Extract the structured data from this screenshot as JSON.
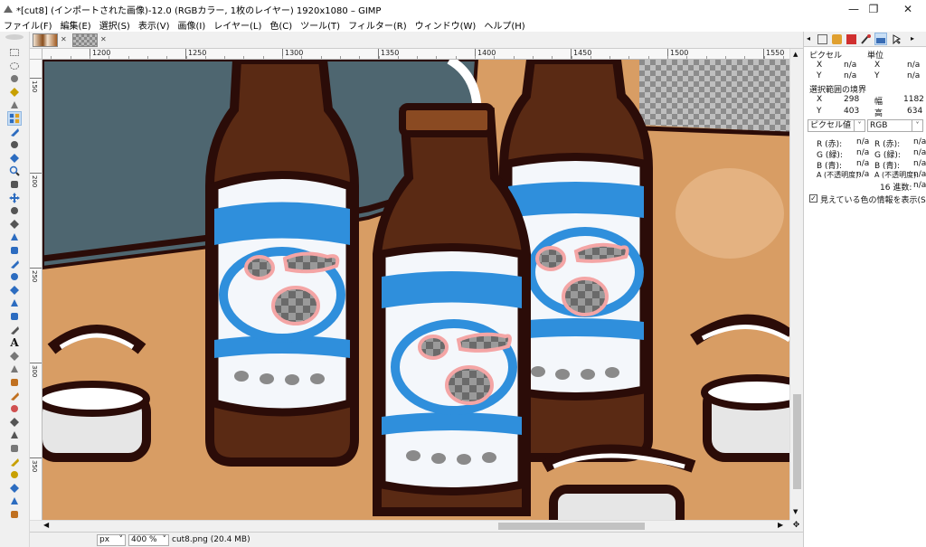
{
  "window": {
    "title": "*[cut8] (インポートされた画像)-12.0 (RGBカラー, 1枚のレイヤー) 1920x1080 – GIMP",
    "minimize": "—",
    "maximize": "❐",
    "close": "✕"
  },
  "menu": [
    "ファイル(F)",
    "編集(E)",
    "選択(S)",
    "表示(V)",
    "画像(I)",
    "レイヤー(L)",
    "色(C)",
    "ツール(T)",
    "フィルター(R)",
    "ウィンドウ(W)",
    "ヘルプ(H)"
  ],
  "tabs": {
    "close1": "✕",
    "close2": "✕"
  },
  "ruler": {
    "top_labels": [
      "1200",
      "1250",
      "1300",
      "1350",
      "1400",
      "1450",
      "1500",
      "1550"
    ],
    "left_labels": [
      "150",
      "200",
      "250",
      "300",
      "350",
      "400",
      "450",
      "500"
    ]
  },
  "tools": [
    "rect-select-icon",
    "ellipse-select-icon",
    "free-select-icon",
    "fuzzy-select-icon",
    "select-by-color-icon",
    "scissors-icon",
    "foreground-select-icon",
    "paths-icon",
    "color-picker-icon",
    "zoom-icon",
    "measure-icon",
    "move-icon",
    "align-icon",
    "crop-icon",
    "rotate-icon",
    "scale-icon",
    "shear-icon",
    "perspective-icon",
    "transform-icon",
    "flip-icon",
    "cage-icon",
    "warp-icon",
    "text-icon",
    "bucket-fill-icon",
    "gradient-icon",
    "pencil-icon",
    "paintbrush-icon",
    "eraser-icon",
    "airbrush-icon",
    "ink-icon",
    "mypaint-icon",
    "clone-icon",
    "heal-icon",
    "perspective-clone-icon",
    "blur-icon",
    "smudge-icon"
  ],
  "status": {
    "unit": "px",
    "zoom": "400 %",
    "file": "cut8.png (20.4 MB)",
    "nav": "✥"
  },
  "pointer": {
    "pixels_header": "ピクセル",
    "units_header": "単位",
    "x_label": "X",
    "y_label": "Y",
    "px_x": "n/a",
    "px_y": "n/a",
    "unit_x": "n/a",
    "unit_y": "n/a",
    "sel_header": "選択範囲の境界",
    "sel_x": "298",
    "sel_y": "403",
    "width_label": "幅",
    "height_label": "高",
    "width": "1182",
    "height": "634",
    "mode1": "ピクセル値",
    "mode2": "RGB",
    "r_label": "R (赤):",
    "g_label": "G (緑):",
    "b_label": "B (青):",
    "a_label": "A (不透明度):",
    "na": "n/a",
    "colors_label": "16 進数:",
    "sample_label": "見えている色の情報を表示(S)"
  },
  "colors": {
    "wall": "#4e6670",
    "table": "#d89d64",
    "bottle": "#5a2a14",
    "label_blue": "#2f8fdc",
    "outline": "#2b0c08"
  }
}
